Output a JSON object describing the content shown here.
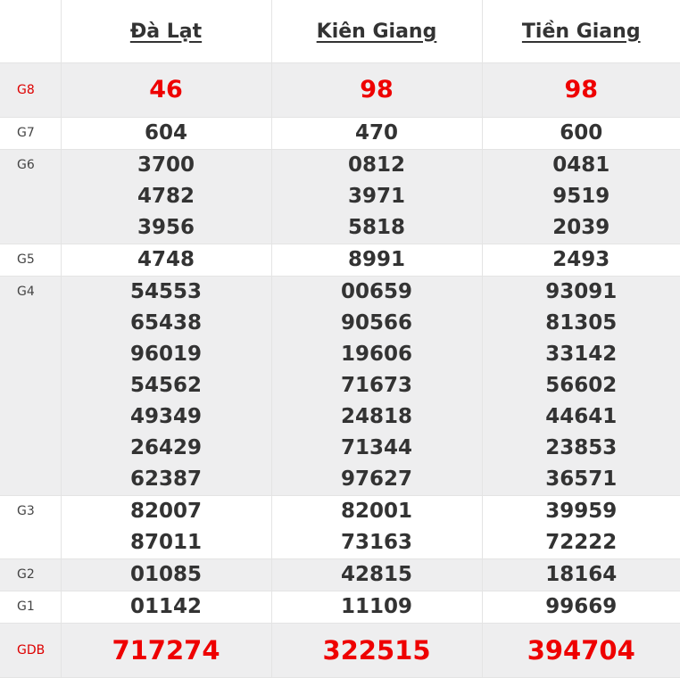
{
  "headers": [
    "Đà Lạt",
    "Kiên Giang",
    "Tiền Giang"
  ],
  "rows": [
    {
      "label": "G8",
      "values": [
        [
          "46"
        ],
        [
          "98"
        ],
        [
          "98"
        ]
      ]
    },
    {
      "label": "G7",
      "values": [
        [
          "604"
        ],
        [
          "470"
        ],
        [
          "600"
        ]
      ]
    },
    {
      "label": "G6",
      "values": [
        [
          "3700",
          "4782",
          "3956"
        ],
        [
          "0812",
          "3971",
          "5818"
        ],
        [
          "0481",
          "9519",
          "2039"
        ]
      ]
    },
    {
      "label": "G5",
      "values": [
        [
          "4748"
        ],
        [
          "8991"
        ],
        [
          "2493"
        ]
      ]
    },
    {
      "label": "G4",
      "values": [
        [
          "54553",
          "65438",
          "96019",
          "54562",
          "49349",
          "26429",
          "62387"
        ],
        [
          "00659",
          "90566",
          "19606",
          "71673",
          "24818",
          "71344",
          "97627"
        ],
        [
          "93091",
          "81305",
          "33142",
          "56602",
          "44641",
          "23853",
          "36571"
        ]
      ]
    },
    {
      "label": "G3",
      "values": [
        [
          "82007",
          "87011"
        ],
        [
          "82001",
          "73163"
        ],
        [
          "39959",
          "72222"
        ]
      ]
    },
    {
      "label": "G2",
      "values": [
        [
          "01085"
        ],
        [
          "42815"
        ],
        [
          "18164"
        ]
      ]
    },
    {
      "label": "G1",
      "values": [
        [
          "01142"
        ],
        [
          "11109"
        ],
        [
          "99669"
        ]
      ]
    },
    {
      "label": "GDB",
      "values": [
        [
          "717274"
        ],
        [
          "322515"
        ],
        [
          "394704"
        ]
      ]
    }
  ]
}
